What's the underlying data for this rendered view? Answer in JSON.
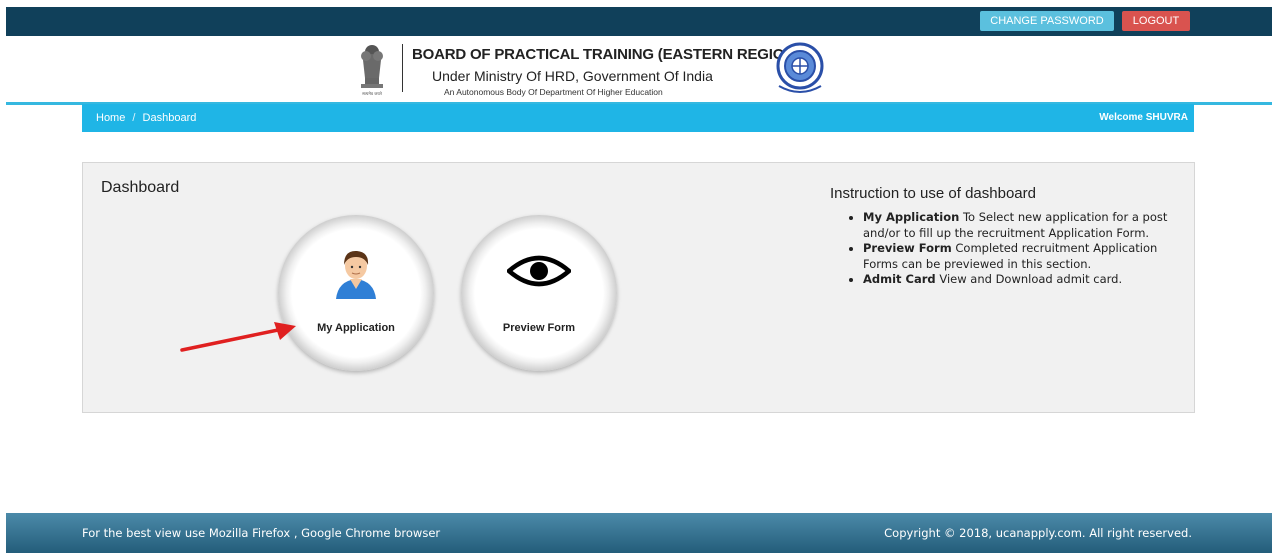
{
  "topbar": {
    "change_password_label": "CHANGE PASSWORD",
    "logout_label": "LOGOUT"
  },
  "header": {
    "title": "BOARD OF PRACTICAL TRAINING (EASTERN REGION)",
    "subtitle": "Under Ministry Of HRD, Government Of India",
    "tagline": "An Autonomous Body Of Department Of Higher Education",
    "left_logo": "state-emblem",
    "right_logo": "bopt-seal"
  },
  "breadcrumb": {
    "items": [
      "Home",
      "Dashboard"
    ],
    "separator": "/",
    "welcome": "Welcome SHUVRA"
  },
  "dashboard": {
    "title": "Dashboard",
    "tiles": [
      {
        "label": "My Application",
        "icon": "user-avatar-icon"
      },
      {
        "label": "Preview Form",
        "icon": "eye-icon"
      }
    ]
  },
  "instructions": {
    "title": "Instruction to use of dashboard",
    "items": [
      {
        "term": "My Application",
        "text": " To Select new application for a post and/or to fill up the recruitment Application Form."
      },
      {
        "term": "Preview Form",
        "text": " Completed recruitment Application Forms can be previewed in this section."
      },
      {
        "term": "Admit Card",
        "text": " View and Download admit card."
      }
    ]
  },
  "footer": {
    "left": "For the best view use Mozilla Firefox , Google Chrome browser",
    "right": "Copyright © 2018, ucanapply.com. All right reserved."
  },
  "colors": {
    "topbar": "#10405a",
    "breadcrumb": "#1fb5e6",
    "change_password": "#5bc0de",
    "logout": "#d9534f",
    "annotation_arrow": "#e02020"
  }
}
